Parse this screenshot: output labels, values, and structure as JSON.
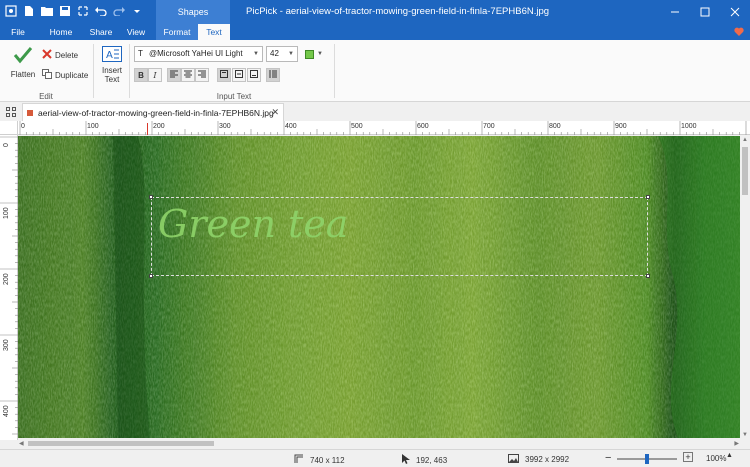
{
  "window": {
    "title": "PicPick - aerial-view-of-tractor-mowing-green-field-in-finla-7EPHB6N.jpg",
    "context_tab_group": "Shapes"
  },
  "ribbon": {
    "tabs": [
      {
        "label": "File",
        "active": false,
        "contextual": false
      },
      {
        "label": "Home",
        "active": false,
        "contextual": false
      },
      {
        "label": "Share",
        "active": false,
        "contextual": false
      },
      {
        "label": "View",
        "active": false,
        "contextual": false
      },
      {
        "label": "Format",
        "active": false,
        "contextual": true
      },
      {
        "label": "Text",
        "active": true,
        "contextual": true
      }
    ],
    "edit_group": {
      "label": "Edit",
      "flatten": "Flatten",
      "delete": "Delete",
      "duplicate": "Duplicate"
    },
    "insert_text": {
      "line1": "Insert",
      "line2": "Text"
    },
    "input_text_group": {
      "label": "Input Text",
      "font_name": "@Microsoft YaHei UI Light",
      "font_size": "42",
      "bold_label": "B",
      "italic_label": "I",
      "text_color": "#74c84a"
    }
  },
  "document": {
    "tab_name": "aerial-view-of-tractor-mowing-green-field-in-finla-7EPHB6N.jpg"
  },
  "rulers": {
    "horizontal": [
      "0",
      "100",
      "200",
      "300",
      "400",
      "500",
      "600",
      "700",
      "800",
      "900",
      "1000"
    ],
    "vertical": [
      "0",
      "100",
      "200",
      "300",
      "400"
    ]
  },
  "canvas": {
    "overlay_text": "Green tea"
  },
  "status": {
    "selection_size": "740 x 112",
    "cursor_position": "192, 463",
    "image_size": "3992 x 2992",
    "zoom": "100%",
    "zoom_minus": "−",
    "zoom_plus": "+"
  }
}
